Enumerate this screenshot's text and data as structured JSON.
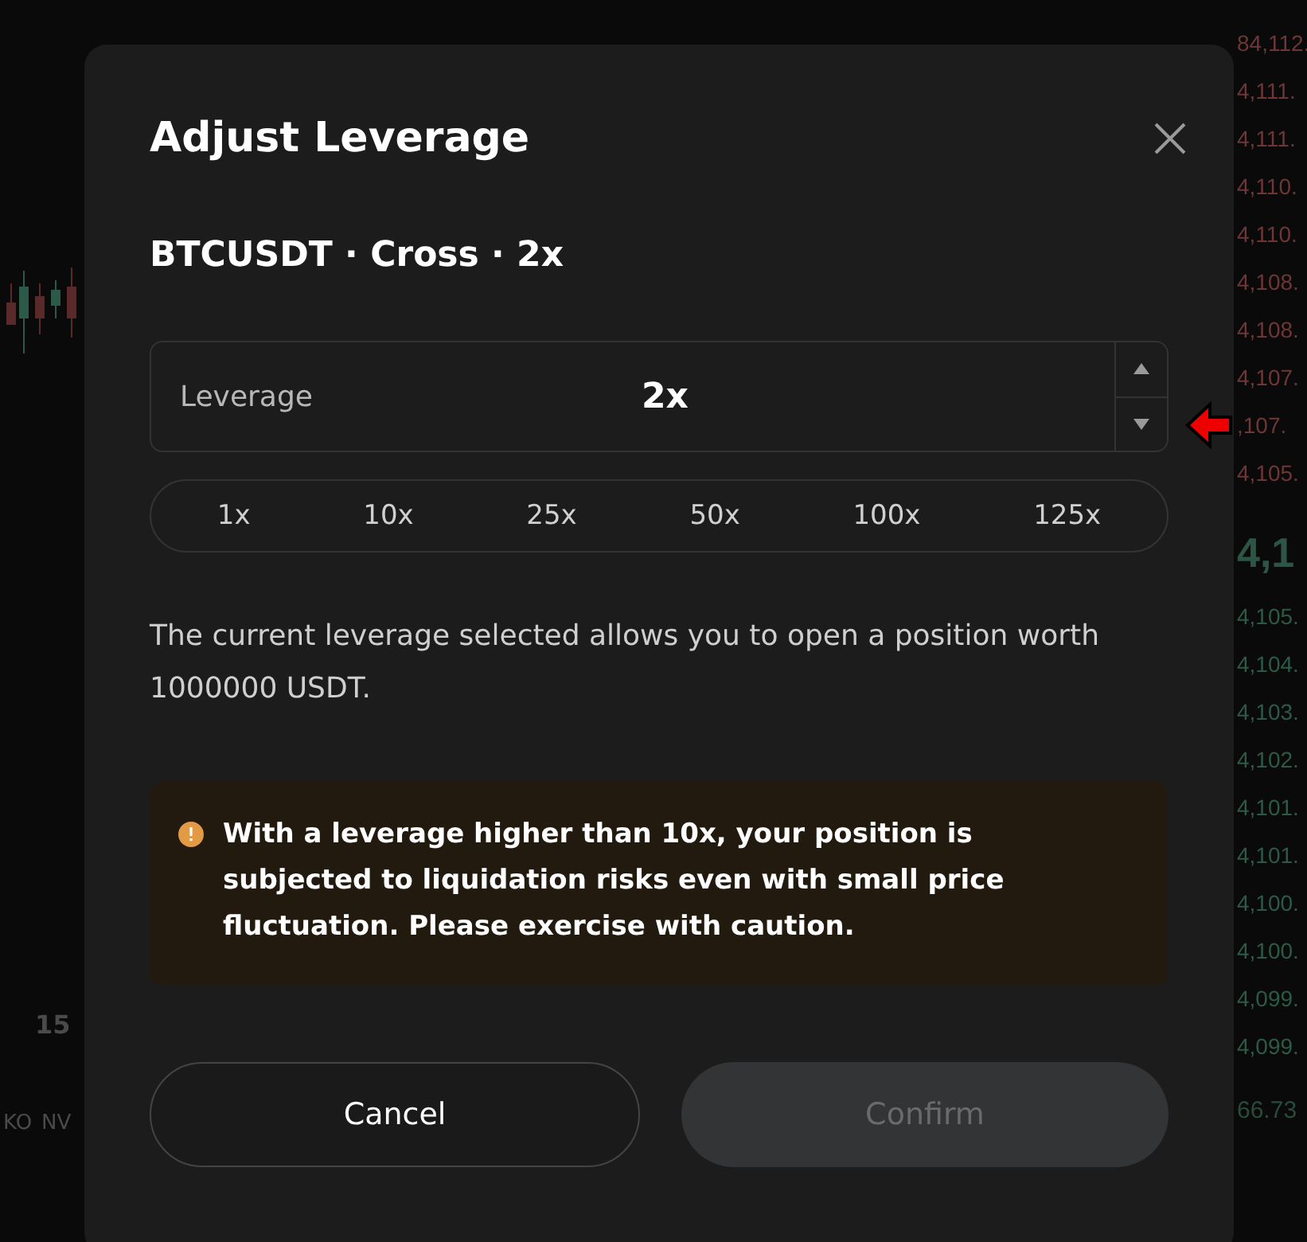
{
  "background": {
    "chart": {
      "axis_label": "15",
      "tickers": [
        "KO",
        "NV"
      ]
    },
    "order_book": {
      "asks": [
        "84,112.",
        "4,111.",
        "4,111.",
        "4,110.",
        "4,110.",
        "4,108.",
        "4,108.",
        "4,107.",
        ",107.",
        "4,105."
      ],
      "mid_price": "4,1",
      "bids": [
        "4,105.",
        "4,104.",
        "4,103.",
        "4,102.",
        "4,101.",
        "4,101.",
        "4,100.",
        "4,100.",
        "4,099.",
        "4,099."
      ],
      "footer": "66.73"
    }
  },
  "dialog": {
    "title": "Adjust Leverage",
    "subtitle": "BTCUSDT · Cross · 2x",
    "leverage_field": {
      "label": "Leverage",
      "value": "2x"
    },
    "presets": [
      {
        "label": "1x",
        "selected": false
      },
      {
        "label": "10x",
        "selected": false
      },
      {
        "label": "25x",
        "selected": false
      },
      {
        "label": "50x",
        "selected": false
      },
      {
        "label": "100x",
        "selected": false
      },
      {
        "label": "125x",
        "selected": false
      }
    ],
    "description": "The current leverage selected allows you to open a position worth 1000000 USDT.",
    "warning": "With a leverage higher than 10x, your position is subjected to liquidation risks even with small price fluctuation. Please exercise with caution.",
    "buttons": [
      {
        "label": "Cancel",
        "kind": "secondary",
        "disabled": false
      },
      {
        "label": "Confirm",
        "kind": "primary",
        "disabled": true
      }
    ]
  }
}
